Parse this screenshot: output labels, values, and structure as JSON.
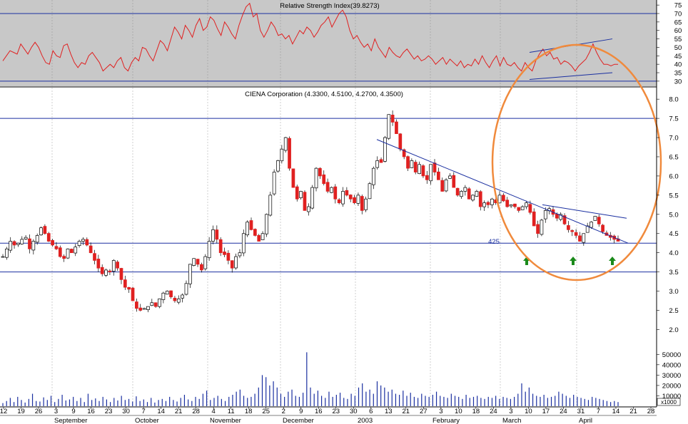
{
  "chart_data": [
    {
      "panel": "rsi",
      "type": "line",
      "title": "Relative Strength Index(39.8273)",
      "ylim": [
        27,
        78
      ],
      "y_ticks": [
        30,
        35,
        40,
        45,
        50,
        55,
        60,
        65,
        70,
        75
      ],
      "reference_lines": [
        70,
        30
      ],
      "series": [
        {
          "values": [
            42,
            45,
            48,
            47,
            46,
            52,
            49,
            46,
            50,
            53,
            50,
            45,
            41,
            40,
            48,
            45,
            44,
            51,
            52,
            46,
            41,
            38,
            41,
            40,
            45,
            47,
            44,
            41,
            36,
            38,
            40,
            38,
            42,
            44,
            38,
            36,
            41,
            44,
            42,
            50,
            49,
            45,
            42,
            48,
            54,
            52,
            48,
            55,
            62,
            59,
            55,
            63,
            60,
            56,
            63,
            67,
            60,
            62,
            68,
            66,
            61,
            57,
            65,
            62,
            58,
            55,
            63,
            69,
            74,
            76,
            68,
            70,
            60,
            56,
            60,
            65,
            62,
            57,
            58,
            55,
            57,
            52,
            56,
            60,
            58,
            62,
            60,
            56,
            59,
            63,
            65,
            68,
            62,
            66,
            70,
            72,
            68,
            60,
            55,
            57,
            53,
            50,
            52,
            48,
            55,
            50,
            47,
            44,
            50,
            47,
            45,
            44,
            47,
            49,
            46,
            43,
            45,
            42,
            43,
            45,
            43,
            40,
            42,
            44,
            40,
            43,
            41,
            39,
            42,
            38,
            40,
            39,
            43,
            40,
            45,
            41,
            38,
            42,
            45,
            39,
            44,
            40,
            39,
            41,
            38,
            36,
            41,
            38,
            36,
            42,
            46,
            49,
            45,
            47,
            43,
            44,
            40,
            42,
            41,
            39,
            36,
            39,
            41,
            43,
            47,
            52,
            47,
            43,
            40,
            40,
            39,
            40,
            40
          ],
          "colors": {
            "line": "#e02020"
          }
        }
      ],
      "annotations": [
        {
          "type": "trendline",
          "label": "",
          "from": {
            "x": "2003-03-12",
            "y": 47
          },
          "to": {
            "x": "2003-04-25",
            "y": 55
          }
        },
        {
          "type": "trendline",
          "label": "",
          "from": {
            "x": "2003-03-12",
            "y": 31
          },
          "to": {
            "x": "2003-04-25",
            "y": 35
          }
        }
      ]
    },
    {
      "panel": "price",
      "type": "candlestick",
      "title": "CIENA Corporation (4.3300, 4.5100, 4.2700, 4.3500)",
      "ylim": [
        1.6,
        8.3
      ],
      "y_ticks": [
        2.0,
        2.5,
        3.0,
        3.5,
        4.0,
        4.5,
        5.0,
        5.5,
        6.0,
        6.5,
        7.0,
        7.5,
        8.0
      ],
      "y_tick_labels": [
        "2.0",
        "2.5",
        "3.0",
        "3.5",
        "4.0",
        "4.5",
        "5.0",
        "5.5",
        "6.0",
        "6.5",
        "7.0",
        "7.5",
        "8.0"
      ],
      "horizontal_lines": [
        7.5,
        4.25,
        3.5
      ],
      "resistance_trendline": {
        "from": {
          "x": "2003-01-08",
          "y": 6.95
        },
        "to": {
          "x": "2003-04-21",
          "y": 4.25
        }
      },
      "upper_trendline": {
        "from": {
          "x": "2003-03-18",
          "y": 5.25
        },
        "to": {
          "x": "2003-04-18",
          "y": 4.9
        }
      },
      "annotation_label": "425",
      "bottom_markers": [
        "2003-03-11",
        "2003-03-28",
        "2003-04-15"
      ],
      "close_values": [
        3.9,
        4.1,
        4.3,
        4.2,
        4.25,
        4.35,
        4.4,
        4.1,
        4.3,
        4.45,
        4.65,
        4.5,
        4.3,
        4.2,
        4.1,
        3.9,
        3.85,
        4.1,
        4.0,
        4.15,
        4.3,
        4.35,
        4.2,
        4.0,
        3.8,
        3.6,
        3.45,
        3.55,
        3.5,
        3.8,
        3.6,
        3.3,
        3.1,
        3.05,
        2.75,
        2.55,
        2.5,
        2.55,
        2.6,
        2.7,
        2.6,
        2.8,
        2.95,
        3.0,
        2.85,
        2.75,
        2.8,
        2.9,
        3.2,
        3.7,
        3.85,
        3.7,
        3.55,
        3.9,
        4.3,
        4.6,
        4.35,
        4.0,
        3.95,
        3.8,
        3.6,
        3.9,
        4.0,
        4.5,
        4.8,
        4.6,
        4.45,
        4.3,
        4.5,
        5.0,
        5.5,
        6.1,
        6.4,
        6.7,
        7.0,
        6.2,
        5.7,
        5.4,
        5.6,
        5.1,
        5.2,
        5.7,
        6.2,
        6.0,
        5.8,
        5.6,
        5.7,
        5.4,
        5.3,
        5.6,
        5.5,
        5.4,
        5.3,
        5.5,
        5.1,
        5.4,
        5.8,
        6.2,
        6.4,
        6.35,
        7.0,
        7.6,
        7.4,
        7.1,
        6.7,
        6.5,
        6.2,
        6.4,
        6.1,
        6.3,
        6.0,
        5.9,
        6.3,
        6.1,
        5.9,
        5.6,
        5.9,
        6.0,
        5.7,
        5.5,
        5.6,
        5.7,
        5.4,
        5.5,
        5.6,
        5.2,
        5.3,
        5.25,
        5.4,
        5.3,
        5.5,
        5.35,
        5.2,
        5.25,
        5.2,
        5.1,
        5.2,
        5.3,
        5.05,
        4.7,
        4.5,
        4.85,
        5.1,
        5.15,
        5.0,
        4.9,
        5.0,
        4.75,
        4.6,
        4.55,
        4.45,
        4.3,
        4.5,
        4.7,
        4.8,
        4.95,
        4.75,
        4.55,
        4.45,
        4.4,
        4.35,
        4.3
      ]
    },
    {
      "panel": "volume",
      "type": "bar",
      "ylim": [
        0,
        55000
      ],
      "y_tick_labels": [
        "10000",
        "20000",
        "30000",
        "40000",
        "50000"
      ],
      "unit_label": "x1000",
      "values": [
        3000,
        5000,
        8000,
        4000,
        9000,
        6000,
        3500,
        7000,
        12000,
        5000,
        4500,
        8500,
        6000,
        10000,
        4000,
        7000,
        11000,
        5500,
        6500,
        9000,
        5000,
        8000,
        4000,
        12000,
        6000,
        7500,
        5000,
        9000,
        6500,
        4000,
        8000,
        5500,
        10000,
        6000,
        7000,
        4500,
        9500,
        5000,
        6500,
        4000,
        8000,
        3500,
        6000,
        7000,
        5000,
        9000,
        6000,
        4500,
        8000,
        11000,
        6500,
        5000,
        9000,
        7000,
        12000,
        15000,
        6000,
        8000,
        10000,
        7000,
        5000,
        9000,
        11000,
        14000,
        16000,
        10000,
        8000,
        9000,
        12000,
        18000,
        30000,
        28000,
        20000,
        24000,
        18000,
        12000,
        9000,
        14000,
        16000,
        10000,
        9000,
        13000,
        52000,
        18000,
        12000,
        15000,
        10000,
        8000,
        14000,
        9000,
        11000,
        13000,
        8000,
        7000,
        12000,
        10000,
        18000,
        22000,
        14000,
        16000,
        12000,
        24000,
        20000,
        18000,
        14000,
        16000,
        12000,
        11000,
        15000,
        10000,
        13000,
        9000,
        8000,
        12000,
        10000,
        9000,
        11000,
        14000,
        10000,
        9000,
        8000,
        12000,
        10000,
        9000,
        7000,
        11000,
        8000,
        9000,
        10000,
        8000,
        7000,
        9000,
        8000,
        10000,
        7000,
        9000,
        8000,
        7000,
        9000,
        12000,
        22000,
        14000,
        18000,
        12000,
        10000,
        9000,
        11000,
        8000,
        9000,
        10000,
        14000,
        12000,
        10000,
        8000,
        11000,
        9000,
        8000,
        7000,
        6000,
        9000,
        8000,
        7000,
        6000,
        5000,
        4000,
        5000,
        4000
      ]
    },
    {
      "panel": "x_axis",
      "type": "table",
      "day_labels": [
        "12",
        "19",
        "26",
        "3",
        "9",
        "16",
        "23",
        "30",
        "7",
        "14",
        "21",
        "28",
        "4",
        "11",
        "18",
        "25",
        "2",
        "9",
        "16",
        "23",
        "30",
        "6",
        "13",
        "21",
        "27",
        "3",
        "10",
        "18",
        "24",
        "3",
        "10",
        "17",
        "24",
        "31",
        "7",
        "14",
        "21",
        "28"
      ],
      "month_labels": [
        "September",
        "October",
        "November",
        "December",
        "2003",
        "February",
        "March",
        "April"
      ]
    }
  ]
}
